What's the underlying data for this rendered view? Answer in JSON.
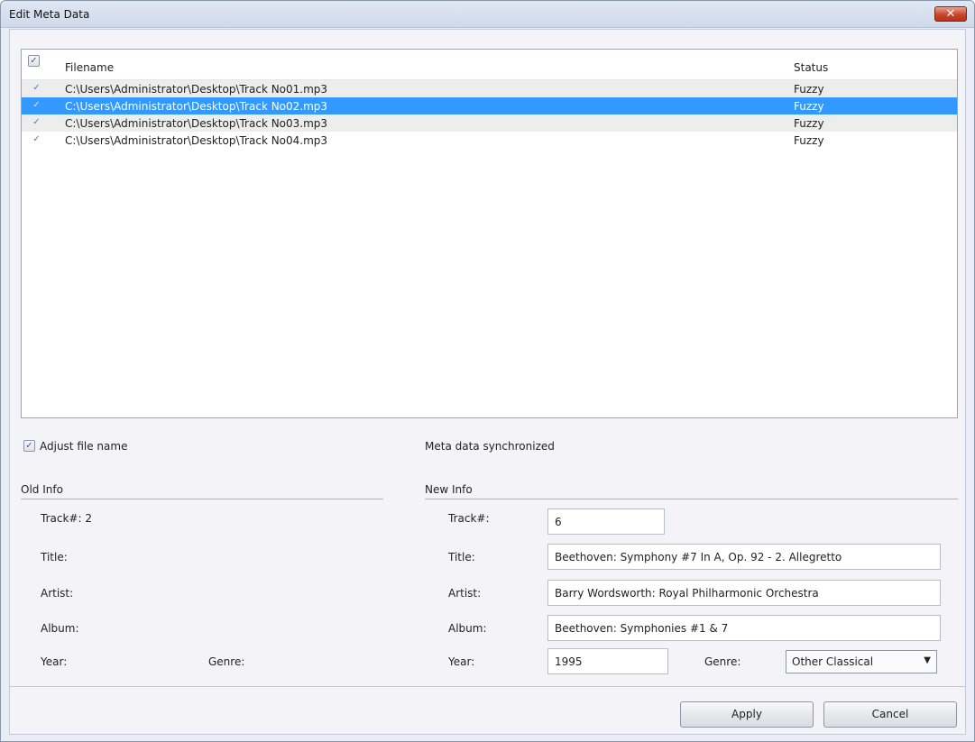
{
  "window": {
    "title": "Edit Meta Data",
    "close_glyph": "✕"
  },
  "list": {
    "headers": {
      "filename": "Filename",
      "status": "Status"
    },
    "check_glyph": "✓",
    "rows": [
      {
        "filename": "C:\\Users\\Administrator\\Desktop\\Track No01.mp3",
        "status": "Fuzzy"
      },
      {
        "filename": "C:\\Users\\Administrator\\Desktop\\Track No02.mp3",
        "status": "Fuzzy"
      },
      {
        "filename": "C:\\Users\\Administrator\\Desktop\\Track No03.mp3",
        "status": "Fuzzy"
      },
      {
        "filename": "C:\\Users\\Administrator\\Desktop\\Track No04.mp3",
        "status": "Fuzzy"
      }
    ]
  },
  "options": {
    "adjust_file_name": "Adjust file name",
    "sync_status": "Meta data synchronized"
  },
  "old_info": {
    "heading": "Old Info",
    "track_label": "Track#: 2",
    "title_label": "Title:",
    "artist_label": "Artist:",
    "album_label": "Album:",
    "year_label": "Year:",
    "genre_label": "Genre:"
  },
  "new_info": {
    "heading": "New Info",
    "track_label": "Track#:",
    "track_value": "6",
    "title_label": "Title:",
    "title_value": "Beethoven: Symphony #7 In A, Op. 92 - 2. Allegretto",
    "artist_label": "Artist:",
    "artist_value": "Barry Wordsworth: Royal Philharmonic Orchestra",
    "album_label": "Album:",
    "album_value": "Beethoven: Symphonies #1 & 7",
    "year_label": "Year:",
    "year_value": "1995",
    "genre_label": "Genre:",
    "genre_value": "Other Classical"
  },
  "buttons": {
    "apply": "Apply",
    "cancel": "Cancel"
  },
  "colors": {
    "selection": "#3399ff",
    "close": "#c9452e"
  }
}
